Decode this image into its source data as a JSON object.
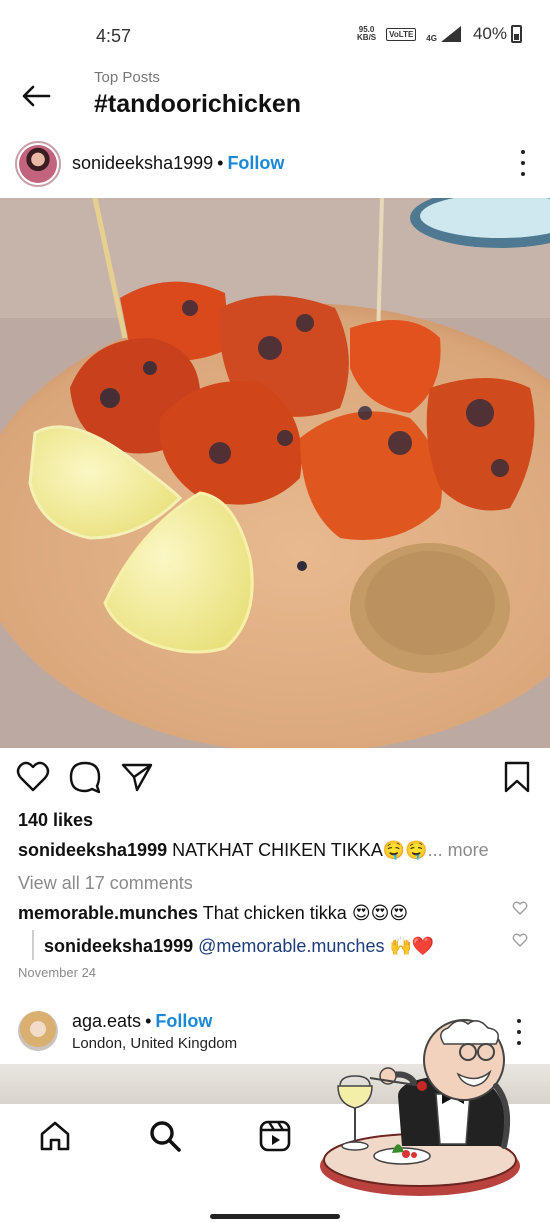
{
  "status": {
    "time": "4:57",
    "net_speed_value": "95.0",
    "net_speed_unit": "KB/S",
    "volte": "VoLTE",
    "network": "4G",
    "battery": "40%"
  },
  "header": {
    "subtitle": "Top Posts",
    "title": "#tandoorichicken",
    "back_icon": "arrow-left-icon"
  },
  "post": {
    "username": "sonideeksha1999",
    "separator": "•",
    "follow_label": "Follow",
    "more_icon": "more-vertical-icon",
    "image_alt": "Tandoori chicken tikka on plate with lemon wedges",
    "actions": [
      "heart-icon",
      "comment-icon",
      "share-icon",
      "bookmark-icon"
    ],
    "likes": "140 likes",
    "caption_user": "sonideeksha1999",
    "caption_text": "NATKHAT CHIKEN TIKKA🤤🤤",
    "caption_more": "... more",
    "view_comments": "View all 17 comments",
    "comments": [
      {
        "user": "memorable.munches",
        "text": "That chicken tikka 😍😍😍"
      },
      {
        "user": "sonideeksha1999",
        "mention": "@memorable.munches",
        "text": "🙌❤️"
      }
    ],
    "date": "November 24"
  },
  "post2": {
    "username": "aga.eats",
    "separator": "•",
    "follow_label": "Follow",
    "location": "London, United Kingdom"
  },
  "nav": {
    "items": [
      "home-icon",
      "search-icon",
      "reels-icon",
      "shop-icon",
      "profile-icon"
    ]
  },
  "colors": {
    "follow": "#1a88d6",
    "muted": "#8a8a8a",
    "mention": "#1e3c7a"
  }
}
